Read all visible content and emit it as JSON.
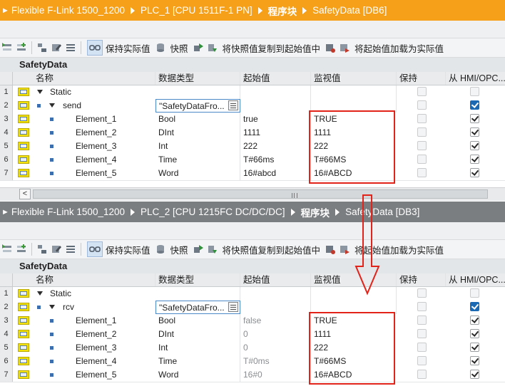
{
  "top": {
    "breadcrumb": [
      "Flexible F-Link 1500_1200",
      "PLC_1 [CPU 1511F-1 PN]",
      "程序块",
      "SafetyData [DB6]"
    ],
    "block_name": "SafetyData",
    "rows": [
      {
        "num": "1",
        "name": "Static",
        "type": "",
        "start": "",
        "monitor": ""
      },
      {
        "num": "2",
        "name": "send",
        "type": "\"SafetyDataFro...",
        "start": "",
        "monitor": ""
      },
      {
        "num": "3",
        "name": "Element_1",
        "type": "Bool",
        "start": "true",
        "monitor": "TRUE"
      },
      {
        "num": "4",
        "name": "Element_2",
        "type": "DInt",
        "start": "1111",
        "monitor": "1111"
      },
      {
        "num": "5",
        "name": "Element_3",
        "type": "Int",
        "start": "222",
        "monitor": "222"
      },
      {
        "num": "6",
        "name": "Element_4",
        "type": "Time",
        "start": "T#66ms",
        "monitor": "T#66MS"
      },
      {
        "num": "7",
        "name": "Element_5",
        "type": "Word",
        "start": "16#abcd",
        "monitor": "16#ABCD"
      }
    ]
  },
  "bottom": {
    "breadcrumb": [
      "Flexible F-Link 1500_1200",
      "PLC_2 [CPU 1215FC DC/DC/DC]",
      "程序块",
      "SafetyData [DB3]"
    ],
    "block_name": "SafetyData",
    "rows": [
      {
        "num": "1",
        "name": "Static",
        "type": "",
        "start": "",
        "monitor": ""
      },
      {
        "num": "2",
        "name": "rcv",
        "type": "\"SafetyDataFro...",
        "start": "",
        "monitor": ""
      },
      {
        "num": "3",
        "name": "Element_1",
        "type": "Bool",
        "start": "false",
        "monitor": "TRUE"
      },
      {
        "num": "4",
        "name": "Element_2",
        "type": "DInt",
        "start": "0",
        "monitor": "1111"
      },
      {
        "num": "5",
        "name": "Element_3",
        "type": "Int",
        "start": "0",
        "monitor": "222"
      },
      {
        "num": "6",
        "name": "Element_4",
        "type": "Time",
        "start": "T#0ms",
        "monitor": "T#66MS"
      },
      {
        "num": "7",
        "name": "Element_5",
        "type": "Word",
        "start": "16#0",
        "monitor": "16#ABCD"
      }
    ]
  },
  "toolbar": {
    "keep_actual": "保持实际值",
    "snapshot": "快照",
    "copy_snapshot": "将快照值复制到起始值中",
    "load_start": "将起始值加载为实际值"
  },
  "columns": {
    "name": "名称",
    "data_type": "数据类型",
    "start_value": "起始值",
    "monitor_value": "监视值",
    "retain": "保持",
    "hmi": "从 HMI/OPC..."
  },
  "scrollbar": {
    "left_arrow": "<",
    "grip": "III"
  },
  "colors": {
    "title_active": "#f6a01a",
    "title_inactive": "#7b7e80",
    "monitor_highlight": "#fbc36b",
    "annotation_red": "#e2231a"
  }
}
